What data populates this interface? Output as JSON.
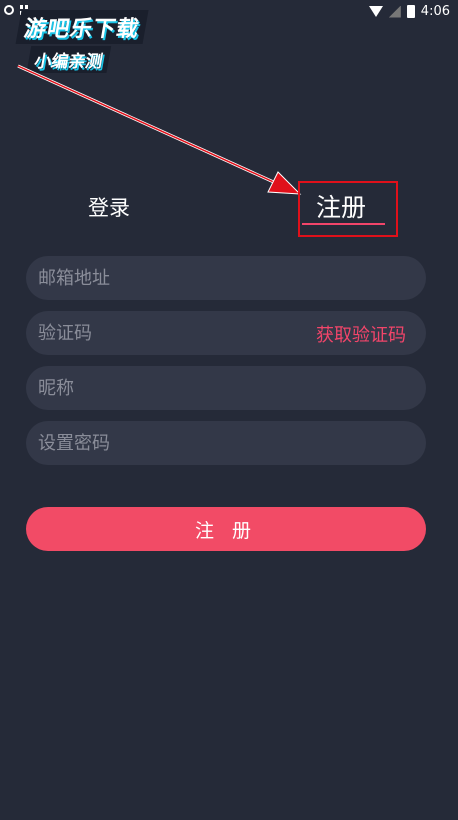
{
  "status_bar": {
    "time": "4:06"
  },
  "watermark": {
    "line1": "游吧乐下载",
    "line2": "小编亲测"
  },
  "tabs": {
    "login": "登录",
    "register": "注册"
  },
  "form": {
    "email_placeholder": "邮箱地址",
    "code_placeholder": "验证码",
    "get_code": "获取验证码",
    "nickname_placeholder": "昵称",
    "password_placeholder": "设置密码"
  },
  "submit_label": "注 册",
  "colors": {
    "background": "#252a38",
    "field": "#333848",
    "accent": "#f24b66",
    "annotation": "#e0101a"
  }
}
